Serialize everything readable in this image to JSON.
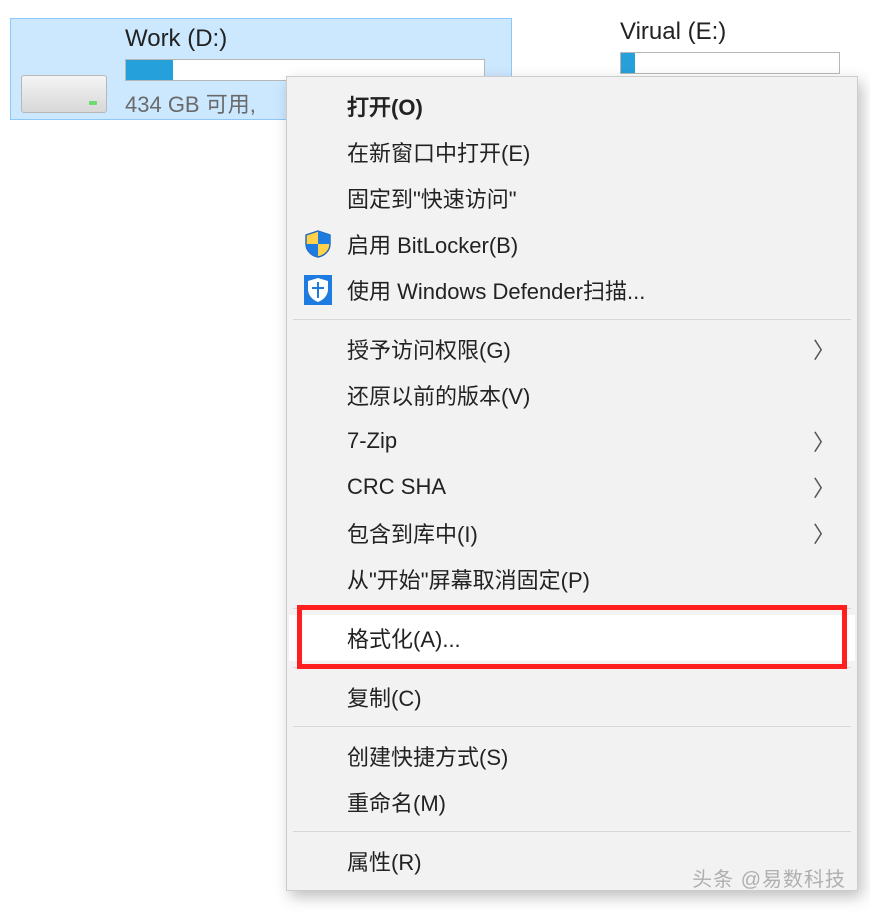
{
  "drives": {
    "d": {
      "label": "Work (D:)",
      "usage_text": "434 GB 可用,",
      "fill_percent": 13
    },
    "e": {
      "label": "Virual (E:)"
    }
  },
  "context_menu": {
    "open": "打开(O)",
    "open_new_window": "在新窗口中打开(E)",
    "pin_quick_access": "固定到\"快速访问\"",
    "bitlocker": "启用 BitLocker(B)",
    "defender": "使用 Windows Defender扫描...",
    "grant_access": "授予访问权限(G)",
    "restore_prev": "还原以前的版本(V)",
    "seven_zip": "7-Zip",
    "crc_sha": "CRC SHA",
    "include_library": "包含到库中(I)",
    "unpin_start": "从\"开始\"屏幕取消固定(P)",
    "format": "格式化(A)...",
    "copy": "复制(C)",
    "create_shortcut": "创建快捷方式(S)",
    "rename": "重命名(M)",
    "properties": "属性(R)"
  },
  "watermark": "头条 @易数科技"
}
